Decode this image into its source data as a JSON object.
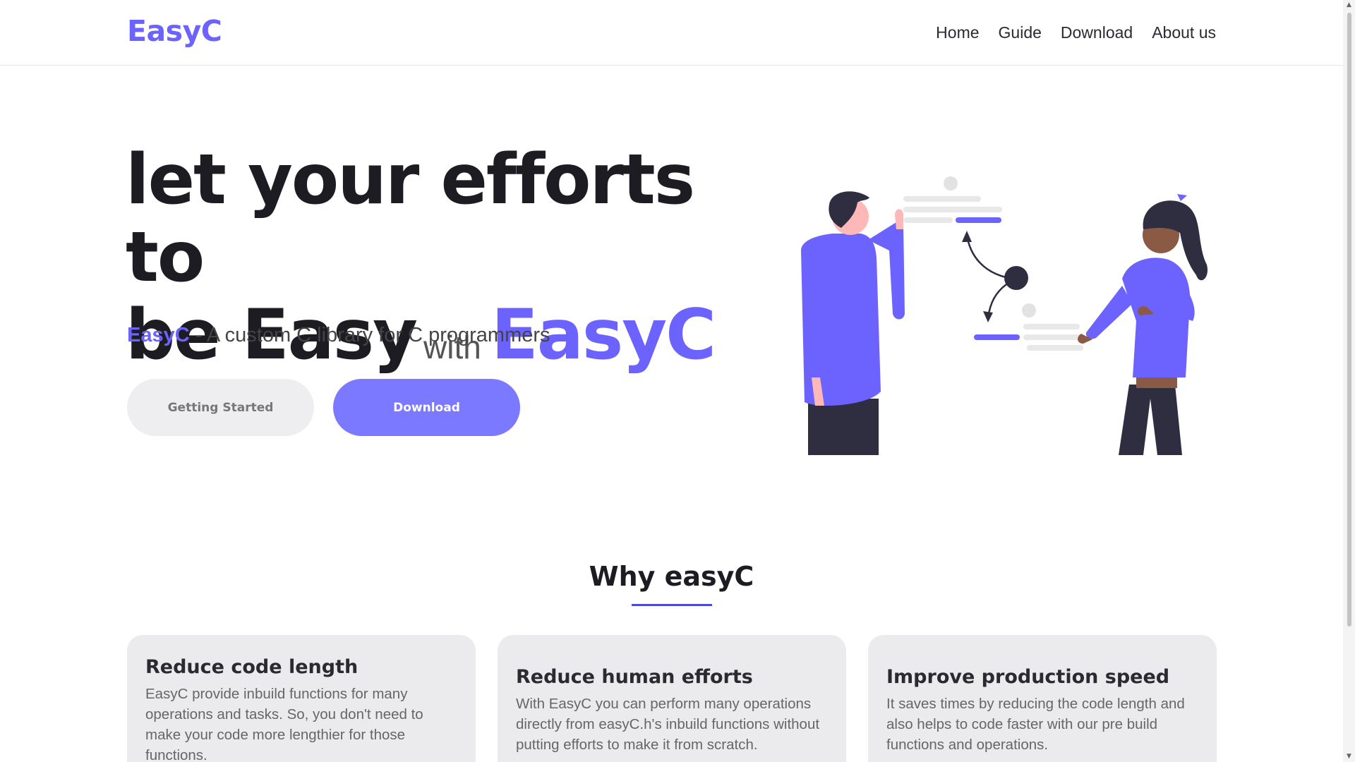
{
  "header": {
    "brand": "EasyC",
    "nav": [
      "Home",
      "Guide",
      "Download",
      "About us"
    ]
  },
  "hero": {
    "title_line1": "let your efforts to",
    "title_line2": "be Easy",
    "title_with": "with",
    "title_brand": "EasyC",
    "tagline_brand": "EasyC",
    "tagline_rest": " - A custom C library for C programmers",
    "btn_start": "Getting Started",
    "btn_download": "Download"
  },
  "why": {
    "title": "Why easyC",
    "cards": [
      {
        "title": "Reduce code length",
        "text": "EasyC provide inbuild functions for many operations and tasks. So, you don't need to make your code more lengthier for those functions."
      },
      {
        "title": "Reduce human efforts",
        "text": "With EasyC you can perform many operations directly from easyC.h's inbuild functions without putting efforts to make it from scratch."
      },
      {
        "title": "Improve production speed",
        "text": "It saves times by reducing the code length and also helps to code faster with our pre build functions and operations."
      }
    ]
  },
  "colors": {
    "accent": "#6c63ff",
    "download_button": "#7b79ff",
    "card_bg": "#ebebee"
  }
}
